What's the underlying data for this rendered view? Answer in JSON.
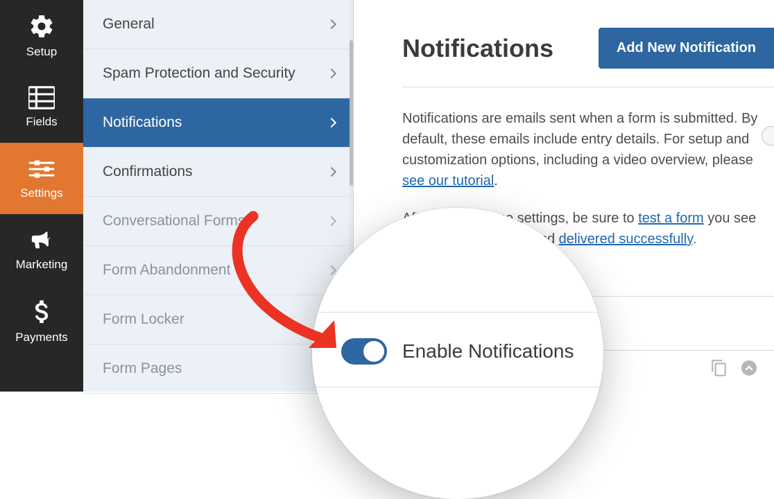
{
  "nav": {
    "items": [
      {
        "key": "setup",
        "label": "Setup",
        "icon": "gear-icon",
        "active": false
      },
      {
        "key": "fields",
        "label": "Fields",
        "icon": "list-icon",
        "active": false
      },
      {
        "key": "settings",
        "label": "Settings",
        "icon": "sliders-icon",
        "active": true
      },
      {
        "key": "marketing",
        "label": "Marketing",
        "icon": "bullhorn-icon",
        "active": false
      },
      {
        "key": "payments",
        "label": "Payments",
        "icon": "dollar-icon",
        "active": false
      }
    ]
  },
  "subpanel": {
    "items": [
      {
        "label": "General",
        "active": false,
        "muted": false
      },
      {
        "label": "Spam Protection and Security",
        "active": false,
        "muted": false
      },
      {
        "label": "Notifications",
        "active": true,
        "muted": false
      },
      {
        "label": "Confirmations",
        "active": false,
        "muted": false
      },
      {
        "label": "Conversational Forms",
        "active": false,
        "muted": true
      },
      {
        "label": "Form Abandonment",
        "active": false,
        "muted": true
      },
      {
        "label": "Form Locker",
        "active": false,
        "muted": true
      },
      {
        "label": "Form Pages",
        "active": false,
        "muted": true
      }
    ]
  },
  "main": {
    "title": "Notifications",
    "add_button_label": "Add New Notification",
    "paragraph1_pre": "Notifications are emails sent when a form is submitted. By default, these emails include entry details. For setup and customization options, including a video overview, please ",
    "paragraph1_link": "see our tutorial",
    "paragraph1_post": ".",
    "paragraph2_pre": "After saving these settings, be sure to ",
    "paragraph2_link1": "test a form",
    "paragraph2_mid": " you see how emails will look, and ",
    "paragraph2_link2": "delivered successfully",
    "paragraph2_post": "."
  },
  "magnifier": {
    "toggle_on": true,
    "toggle_label": "Enable Notifications"
  },
  "colors": {
    "accent_orange": "#e27730",
    "accent_blue": "#2d66a1",
    "nav_bg": "#272727",
    "arrow_red": "#eb3223"
  }
}
